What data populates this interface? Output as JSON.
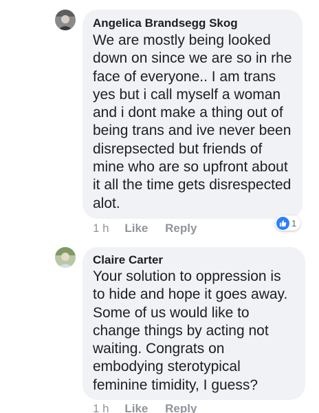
{
  "comments": [
    {
      "author": "Angelica Brandsegg Skog",
      "text": "We are mostly being looked\ndown on since we are so in rhe\nface of everyone.. I am trans\nyes but i call myself a woman\nand i dont make a thing out of\nbeing trans and ive never been\ndisrepsected but friends of\nmine who are so upfront about\nit all the time gets disrespected\nalot.",
      "time": "1 h",
      "like_label": "Like",
      "reply_label": "Reply",
      "reaction_icon": "thumbs-up-icon",
      "reaction_count": "1"
    },
    {
      "author": "Claire Carter",
      "text": "Your solution to oppression is\nto hide and hope it goes away.\nSome of us would like to\nchange things by acting not\nwaiting. Congrats on\nembodying sterotypical\nfeminine timidity, I guess?",
      "time": "1 h",
      "like_label": "Like",
      "reply_label": "Reply"
    }
  ],
  "colors": {
    "bubble": "#f0f2f5",
    "text": "#1c1e21",
    "meta": "#90949c",
    "like_blue": "#2d7ff9"
  }
}
